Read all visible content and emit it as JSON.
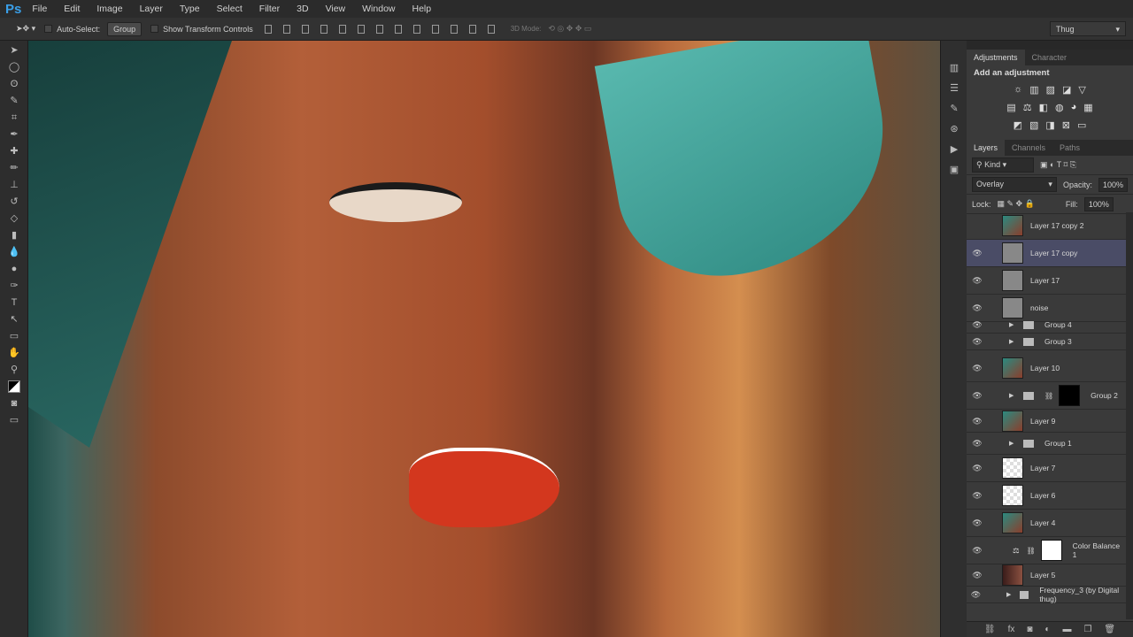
{
  "menu": {
    "logo": "Ps",
    "items": [
      "File",
      "Edit",
      "Image",
      "Layer",
      "Type",
      "Select",
      "Filter",
      "3D",
      "View",
      "Window",
      "Help"
    ]
  },
  "options": {
    "auto_select": "Auto-Select:",
    "auto_select_value": "Group",
    "show_transform": "Show Transform Controls",
    "mode_3d": "3D Mode:",
    "workspace": "Thug"
  },
  "adjustments": {
    "tabs": [
      "Adjustments",
      "Character"
    ],
    "title": "Add an adjustment",
    "rows": [
      [
        "☼",
        "▥",
        "▨",
        "◪",
        "▽"
      ],
      [
        "▤",
        "⚖",
        "◧",
        "◍",
        "◕",
        "▦"
      ],
      [
        "◩",
        "▧",
        "◨",
        "⊠",
        "▭"
      ]
    ]
  },
  "layers": {
    "tabs": [
      "Layers",
      "Channels",
      "Paths"
    ],
    "kind": "Kind",
    "blend_mode": "Overlay",
    "opacity_label": "Opacity:",
    "opacity": "100%",
    "lock_label": "Lock:",
    "fill_label": "Fill:",
    "fill": "100%",
    "items": [
      {
        "name": "Layer 17 copy 2",
        "type": "layer",
        "thumb": "img",
        "visible": false
      },
      {
        "name": "Layer 17 copy",
        "type": "layer",
        "thumb": "gray",
        "visible": true,
        "selected": true
      },
      {
        "name": "Layer 17",
        "type": "layer",
        "thumb": "gray",
        "visible": true
      },
      {
        "name": "noise",
        "type": "layer",
        "thumb": "gray",
        "visible": true
      },
      {
        "name": "Group 4",
        "type": "group",
        "visible": true
      },
      {
        "name": "Group 3",
        "type": "group",
        "visible": true
      },
      {
        "name": "Layer 10",
        "type": "layer",
        "thumb": "img",
        "visible": true
      },
      {
        "name": "Group 2",
        "type": "group-mask",
        "visible": true
      },
      {
        "name": "Layer 9",
        "type": "layer",
        "thumb": "img",
        "visible": true
      },
      {
        "name": "Group 1",
        "type": "group",
        "visible": true
      },
      {
        "name": "Layer 7",
        "type": "layer",
        "thumb": "trans",
        "visible": true
      },
      {
        "name": "Layer 6",
        "type": "layer",
        "thumb": "trans",
        "visible": true
      },
      {
        "name": "Layer 4",
        "type": "layer",
        "thumb": "img",
        "visible": true
      },
      {
        "name": "Color Balance 1",
        "type": "adjustment",
        "visible": true
      },
      {
        "name": "Layer 5",
        "type": "layer",
        "thumb": "dark",
        "visible": true
      },
      {
        "name": "Frequency_3 (by Digital thug)",
        "type": "group",
        "visible": true
      }
    ]
  },
  "colors": {
    "accent": "#3a9fe8",
    "selected_layer": "#4a4c66"
  }
}
